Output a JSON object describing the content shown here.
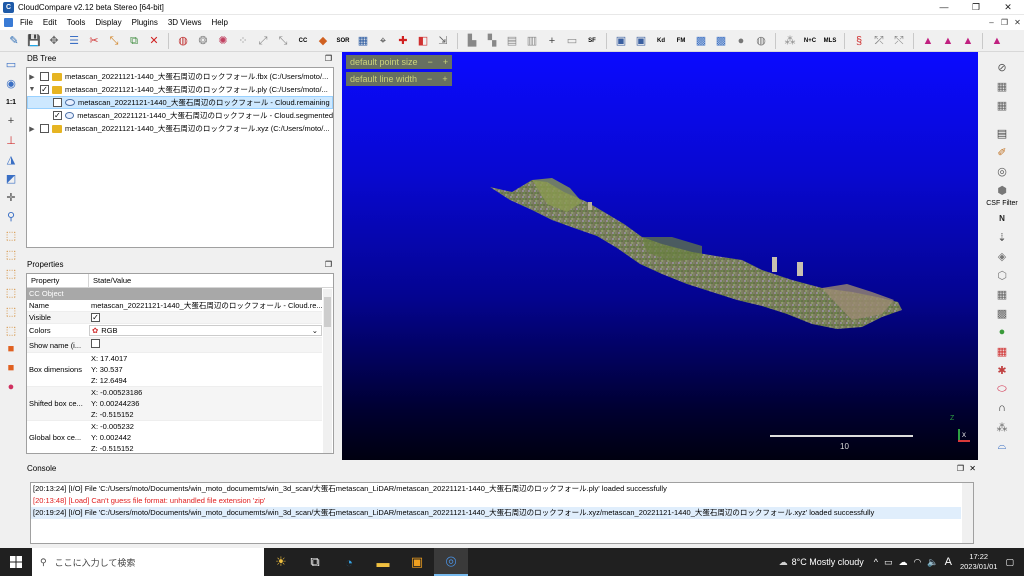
{
  "window": {
    "title": "CloudCompare v2.12 beta Stereo [64-bit]",
    "icon": "cloudcompare-icon"
  },
  "menu": [
    "File",
    "Edit",
    "Tools",
    "Display",
    "Plugins",
    "3D Views",
    "Help"
  ],
  "toolbar": {
    "sor_label": "SOR",
    "sf_label": "SF",
    "kd_label": "Kd",
    "fm_label": "FM",
    "nc_label": "N+C",
    "mls_label": "MLS",
    "cc_label": "CC"
  },
  "db_tree": {
    "title": "DB Tree",
    "rows": [
      {
        "label": "metascan_20221121-1440_大蛋石周辺のロックフォール.fbx (C:/Users/moto/...",
        "checked": false,
        "expanded": false,
        "kind": "folder"
      },
      {
        "label": "metascan_20221121-1440_大蛋石周辺のロックフォール.ply (C:/Users/moto/...",
        "checked": true,
        "expanded": true,
        "kind": "folder"
      },
      {
        "label": "metascan_20221121-1440_大蛋石周辺のロックフォール - Cloud.remaining",
        "checked": false,
        "kind": "cloud",
        "selected": true
      },
      {
        "label": "metascan_20221121-1440_大蛋石周辺のロックフォール - Cloud.segmented",
        "checked": true,
        "kind": "cloud"
      },
      {
        "label": "metascan_20221121-1440_大蛋石周辺のロックフォール.xyz (C:/Users/moto/...",
        "checked": false,
        "expanded": false,
        "kind": "folder"
      }
    ]
  },
  "properties": {
    "title": "Properties",
    "col_property": "Property",
    "col_value": "State/Value",
    "section": "CC Object",
    "name_key": "Name",
    "name_val": "metascan_20221121-1440_大蛋石周辺のロックフォール - Cloud.re...",
    "visible_key": "Visible",
    "colors_key": "Colors",
    "colors_val": "RGB",
    "showname_key": "Show name (i...",
    "boxdim_key": "Box dimensions",
    "boxdim_vals": [
      "X: 17.4017",
      "Y: 30.537",
      "Z: 12.6494"
    ],
    "shifted_key": "Shifted box ce...",
    "shifted_vals": [
      "X: -0.00523186",
      "Y: 0.00244236",
      "Z: -0.515152"
    ],
    "global_key": "Global box ce...",
    "global_vals": [
      "X: -0.005232",
      "Y: 0.002442",
      "Z: -0.515152"
    ]
  },
  "view3d": {
    "point_size_label": "default point size",
    "line_width_label": "default line width",
    "minus": "−",
    "plus": "+",
    "scale_label": "10",
    "axis_z": "Z",
    "axis_x": "X"
  },
  "right_toolbar": {
    "csf_label": "CSF Filter"
  },
  "console": {
    "title": "Console",
    "lines": [
      "[20:13:24] [I/O] File 'C:/Users/moto/Documents/win_moto_documemts/win_3d_scan/大蛋石metascan_LiDAR/metascan_20221121-1440_大蛋石周辺のロックフォール.ply' loaded successfully",
      "[20:13:48] [Load] Can't guess file format: unhandled file extension 'zip'",
      "[20:19:24] [I/O] File 'C:/Users/moto/Documents/win_moto_documemts/win_3d_scan/大蛋石metascan_LiDAR/metascan_20221121-1440_大蛋石周辺のロックフォール.xyz/metascan_20221121-1440_大蛋石周辺のロックフォール.xyz' loaded successfully"
    ]
  },
  "taskbar": {
    "search_placeholder": "ここに入力して検索",
    "weather": "8°C  Mostly cloudy",
    "ime": "A",
    "time": "17:22",
    "date": "2023/01/01"
  }
}
